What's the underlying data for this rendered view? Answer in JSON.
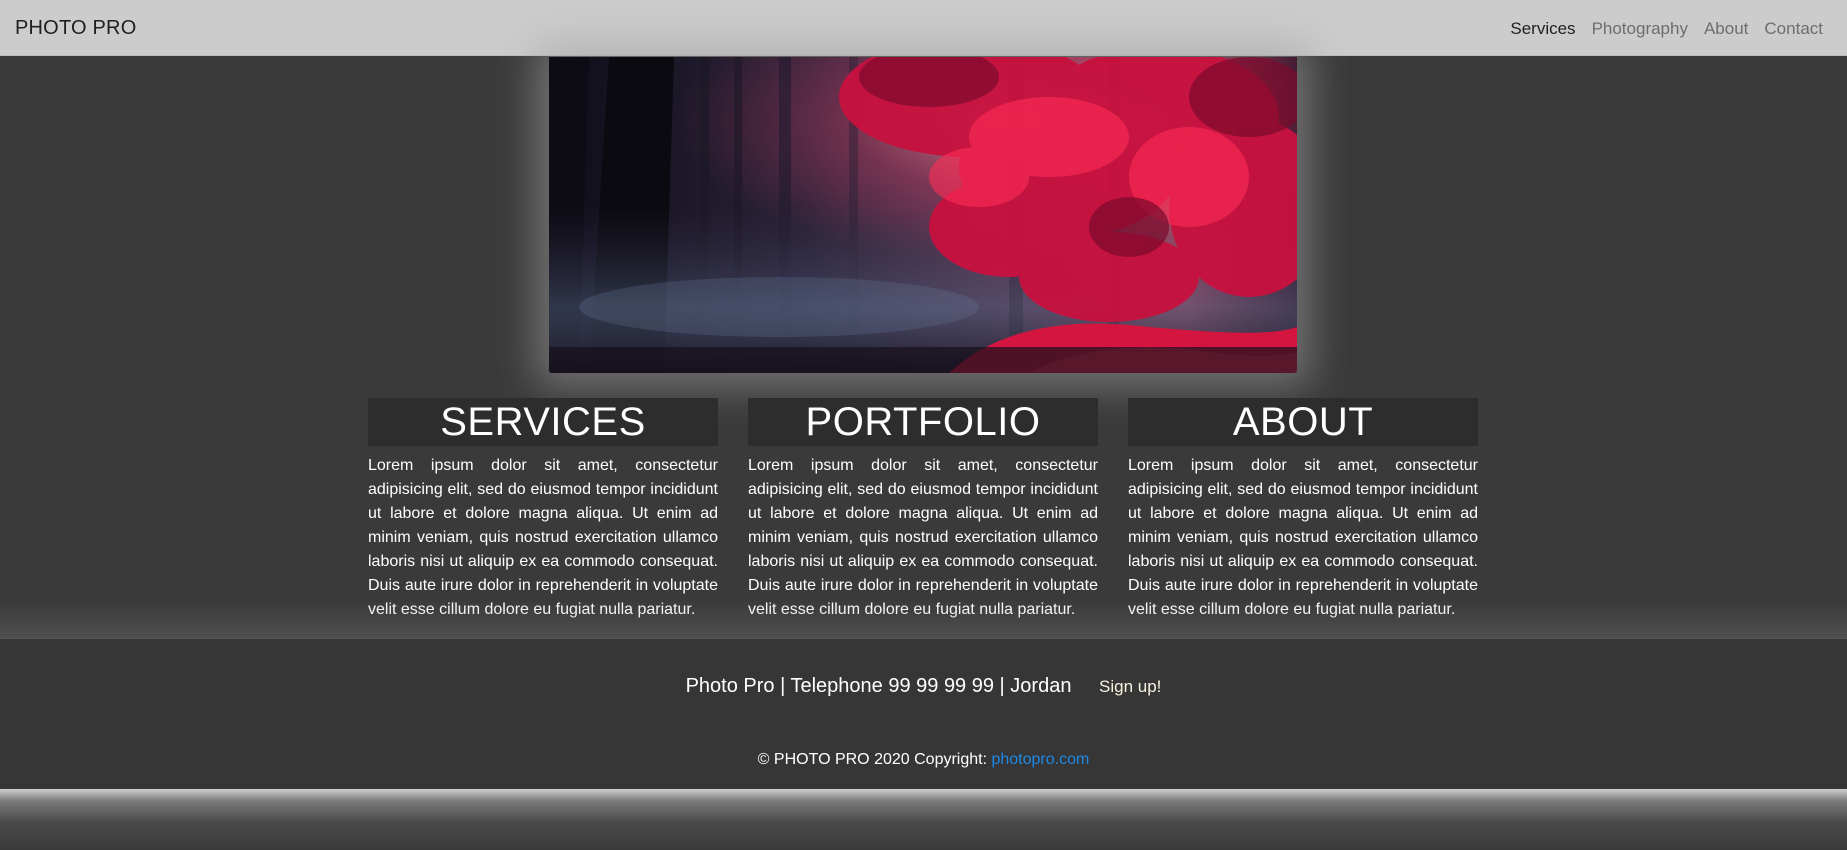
{
  "navbar": {
    "brand": "PHOTO PRO",
    "links": [
      {
        "label": "Services"
      },
      {
        "label": "Photography"
      },
      {
        "label": "About"
      },
      {
        "label": "Contact"
      }
    ]
  },
  "hero": {
    "image": "autumn-forest-red-leaves"
  },
  "sections": [
    {
      "title": "SERVICES",
      "body": "Lorem ipsum dolor sit amet, consectetur adipisicing elit, sed do eiusmod tempor incididunt ut labore et dolore magna aliqua. Ut enim ad minim veniam, quis nostrud exercitation ullamco laboris nisi ut aliquip ex ea commodo consequat. Duis aute irure dolor in reprehenderit in voluptate velit esse cillum dolore eu fugiat nulla pariatur."
    },
    {
      "title": "PORTFOLIO",
      "body": "Lorem ipsum dolor sit amet, consectetur adipisicing elit, sed do eiusmod tempor incididunt ut labore et dolore magna aliqua. Ut enim ad minim veniam, quis nostrud exercitation ullamco laboris nisi ut aliquip ex ea commodo consequat. Duis aute irure dolor in reprehenderit in voluptate velit esse cillum dolore eu fugiat nulla pariatur."
    },
    {
      "title": "ABOUT",
      "body": "Lorem ipsum dolor sit amet, consectetur adipisicing elit, sed do eiusmod tempor incididunt ut labore et dolore magna aliqua. Ut enim ad minim veniam, quis nostrud exercitation ullamco laboris nisi ut aliquip ex ea commodo consequat. Duis aute irure dolor in reprehenderit in voluptate velit esse cillum dolore eu fugiat nulla pariatur."
    }
  ],
  "footer": {
    "contact": "Photo Pro | Telephone 99 99 99 99 | Jordan",
    "signup_label": "Sign up!",
    "copyright_prefix": "© PHOTO PRO 2020 Copyright: ",
    "copyright_link": "photopro.com"
  },
  "colors": {
    "navbar_bg": "#cccccc",
    "page_bg": "#3a3a3a",
    "heading_bg": "#2d2d2d",
    "footer_bg": "#363636",
    "link": "#1e88e5"
  }
}
